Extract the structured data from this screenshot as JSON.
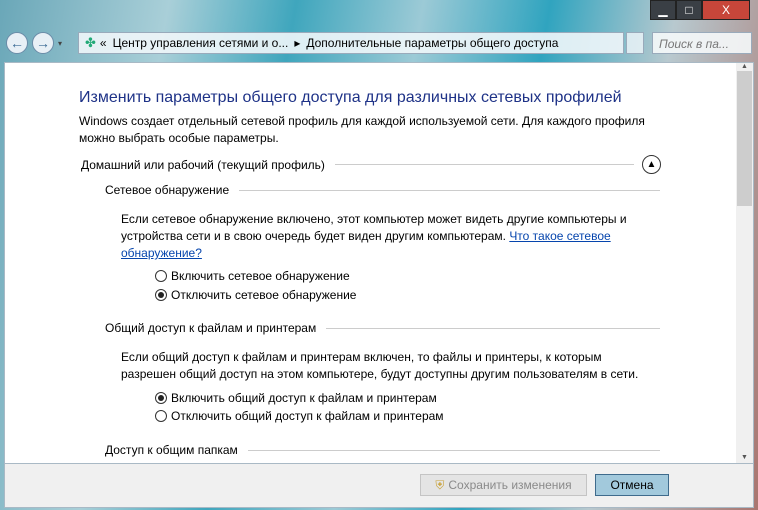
{
  "window": {
    "minimize": "▁",
    "maximize": "□",
    "close": "X"
  },
  "nav": {
    "back": "←",
    "forward": "→",
    "dropdown": "▾",
    "breadcrumb_prefix": "«",
    "crumbs": [
      "Центр управления сетями и о...",
      "Дополнительные параметры общего доступа"
    ],
    "separator": "▸",
    "search_placeholder": "Поиск в па..."
  },
  "main": {
    "title": "Изменить параметры общего доступа для различных сетевых профилей",
    "intro": "Windows создает отдельный сетевой профиль для каждой используемой сети. Для каждого профиля можно выбрать особые параметры.",
    "profile": "Домашний или рабочий (текущий профиль)",
    "sections": [
      {
        "title": "Сетевое обнаружение",
        "desc": "Если сетевое обнаружение включено, этот компьютер может видеть другие компьютеры и устройства сети и в свою очередь будет виден другим компьютерам.",
        "link": "Что такое сетевое обнаружение?",
        "options": [
          "Включить сетевое обнаружение",
          "Отключить сетевое обнаружение"
        ],
        "selected": 1
      },
      {
        "title": "Общий доступ к файлам и принтерам",
        "desc": "Если общий доступ к файлам и принтерам включен, то файлы и принтеры, к которым разрешен общий доступ на этом компьютере, будут доступны другим пользователям в сети.",
        "options": [
          "Включить общий доступ к файлам и принтерам",
          "Отключить общий доступ к файлам и принтерам"
        ],
        "selected": 0
      },
      {
        "title": "Доступ к общим папкам"
      }
    ]
  },
  "footer": {
    "save": "Сохранить изменения",
    "cancel": "Отмена"
  }
}
